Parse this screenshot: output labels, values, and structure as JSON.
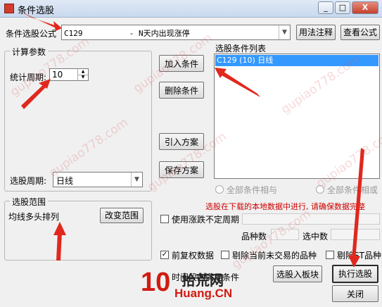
{
  "window": {
    "title": "条件选股",
    "min": "_",
    "max": "□",
    "close": "X"
  },
  "formula": {
    "label": "条件选股公式",
    "value": "C129          - N天内出现涨停",
    "usage_btn": "用法注释",
    "view_btn": "查看公式"
  },
  "params": {
    "group": "计算参数",
    "period_label": "统计周期:",
    "period_value": "10"
  },
  "actions": {
    "add": "加入条件",
    "delete": "删除条件",
    "import": "引入方案",
    "save": "保存方案"
  },
  "condlist": {
    "label": "选股条件列表",
    "items": [
      "C129 (10) 日线"
    ]
  },
  "cycle": {
    "label": "选股周期:",
    "value": "日线"
  },
  "logic": {
    "and": "全部条件相与",
    "or": "全部条件相或"
  },
  "range": {
    "group": "选股范围",
    "value": "均线多头排列",
    "change_btn": "改变范围"
  },
  "notice": "选股在下载的本地数据中进行, 请确保数据完整",
  "indefinite": {
    "label": "使用涨跌不定周期"
  },
  "counts": {
    "kinds_label": "品种数",
    "selected_label": "选中数"
  },
  "options": {
    "adjusted": "前复权数据",
    "exclude_untraded": "剔除当前未交易的品种",
    "exclude_st": "剔除ST品种"
  },
  "time_label": "时间段内满足条件",
  "buttons": {
    "to_block": "选股入板块",
    "execute": "执行选股",
    "close": "关闭"
  },
  "watermark": {
    "site": "gupiao778.com",
    "logo_text": "拾荒网",
    "logo_url": "Huang.CN",
    "logo_num": "10"
  },
  "colors": {
    "selection": "#3399ff",
    "notice": "#d00000",
    "arrow": "#e0281e"
  }
}
